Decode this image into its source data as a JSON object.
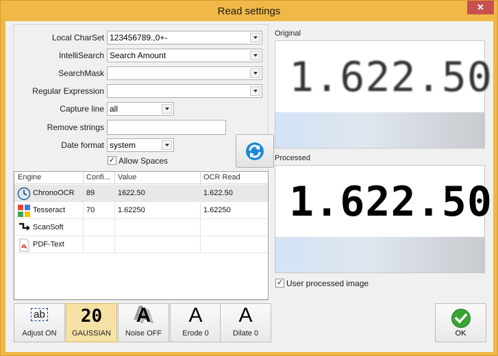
{
  "window": {
    "title": "Read settings",
    "close_glyph": "✕"
  },
  "form": {
    "local_charset": {
      "label": "Local CharSet",
      "value": "123456789.,0+-"
    },
    "intellisearch": {
      "label": "IntelliSearch",
      "value": "Search Amount"
    },
    "searchmask": {
      "label": "SearchMask",
      "value": ""
    },
    "regex": {
      "label": "Regular Expression",
      "value": ""
    },
    "capture_line": {
      "label": "Capture line",
      "value": "all"
    },
    "remove_strings": {
      "label": "Remove strings",
      "value": ""
    },
    "date_format": {
      "label": "Date format",
      "value": "system"
    },
    "allow_spaces": {
      "label": "Allow Spaces",
      "checked": true
    }
  },
  "grid": {
    "columns": [
      "Engine",
      "Confi...",
      "Value",
      "OCR Read"
    ],
    "rows": [
      {
        "engine": "ChronoOCR",
        "icon": "clock-icon",
        "confidence": "89",
        "value": "1622.50",
        "ocr_read": "1.622.50"
      },
      {
        "engine": "Tesseract",
        "icon": "tesseract-icon",
        "confidence": "70",
        "value": "1.62250",
        "ocr_read": "1.62250"
      },
      {
        "engine": "ScanSoft",
        "icon": "scansoft-icon",
        "confidence": "",
        "value": "",
        "ocr_read": ""
      },
      {
        "engine": "PDF-Text",
        "icon": "pdf-icon",
        "confidence": "",
        "value": "",
        "ocr_read": ""
      }
    ]
  },
  "preview": {
    "original_label": "Original",
    "original_text": "1.622.50",
    "processed_label": "Processed",
    "processed_text": "1.622.50",
    "user_processed": {
      "label": "User processed image",
      "checked": true
    }
  },
  "toolbar": {
    "adjust": {
      "label": "Adjust ON",
      "glyph": "ab"
    },
    "gaussian": {
      "label": "GAUSSIAN",
      "glyph": "20"
    },
    "noise": {
      "label": "Noise OFF",
      "glyph": "A"
    },
    "erode": {
      "label": "Erode 0",
      "glyph": "A"
    },
    "dilate": {
      "label": "Dilate 0",
      "glyph": "A"
    }
  },
  "ok": {
    "label": "OK"
  }
}
